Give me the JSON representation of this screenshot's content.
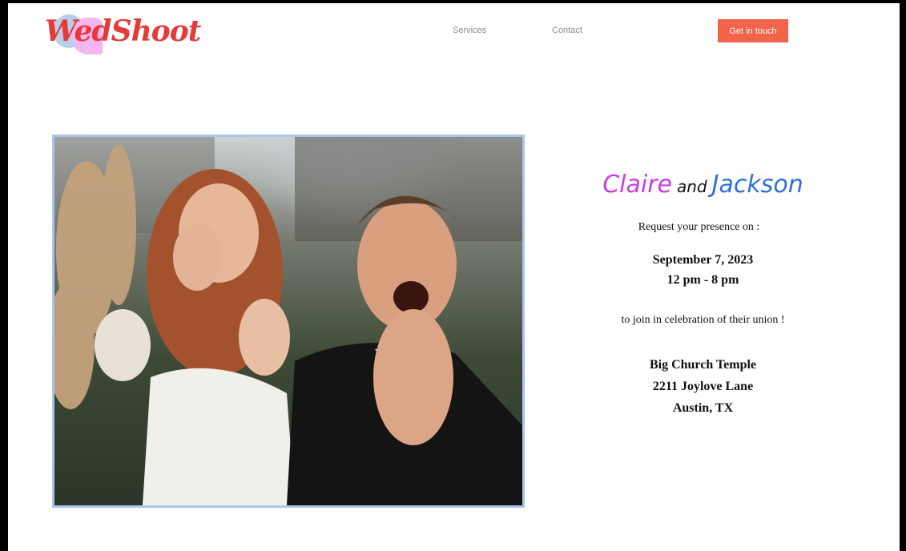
{
  "header": {
    "logo_text": "WedShoot",
    "nav": {
      "services": "Services",
      "contact": "Contact"
    },
    "cta_label": "Get in touch"
  },
  "photo": {
    "alt": "Bride and groom showing wedding rings"
  },
  "invitation": {
    "bride": "Claire",
    "and": "and",
    "groom": "Jackson",
    "request": "Request your presence on :",
    "date": "September 7, 2023",
    "time": "12 pm - 8 pm",
    "join": "to join in celebration of their union !",
    "venue_name": "Big Church Temple",
    "address": "2211 Joylove Lane",
    "city": "Austin, TX"
  },
  "colors": {
    "logo": "#e53a3a",
    "cta": "#f2634a",
    "bride_name": "#c63fe6",
    "groom_name": "#2f6fd8",
    "photo_border": "#a9c6ea"
  }
}
